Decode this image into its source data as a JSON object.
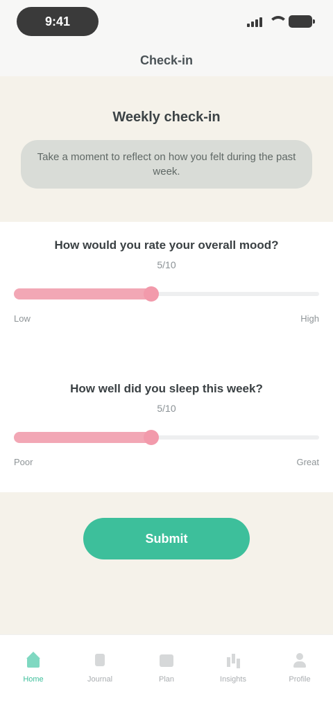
{
  "status_bar": {
    "time": "9:41"
  },
  "header": {
    "title": "Check-in"
  },
  "intro": {
    "title": "Weekly check-in",
    "text": "Take a moment to reflect on how you felt during the past week."
  },
  "questions": [
    {
      "text": "How would you rate your overall mood?",
      "value_text": "5/10",
      "value_fraction": 0.45,
      "min_label": "Low",
      "max_label": "High"
    },
    {
      "text": "How well did you sleep this week?",
      "value_text": "5/10",
      "value_fraction": 0.45,
      "min_label": "Poor",
      "max_label": "Great"
    }
  ],
  "actions": {
    "submit_label": "Submit"
  },
  "tab_bar": {
    "tabs": [
      {
        "label": "Home",
        "icon": "home-icon",
        "active": true
      },
      {
        "label": "Journal",
        "icon": "journal-icon",
        "active": false
      },
      {
        "label": "Plan",
        "icon": "calendar-icon",
        "active": false
      },
      {
        "label": "Insights",
        "icon": "chart-icon",
        "active": false
      },
      {
        "label": "Profile",
        "icon": "user-icon",
        "active": false
      }
    ]
  },
  "colors": {
    "accent": "#3dbf9b",
    "slider": "#f2a7b5",
    "background_warm": "#f5f2ea"
  }
}
